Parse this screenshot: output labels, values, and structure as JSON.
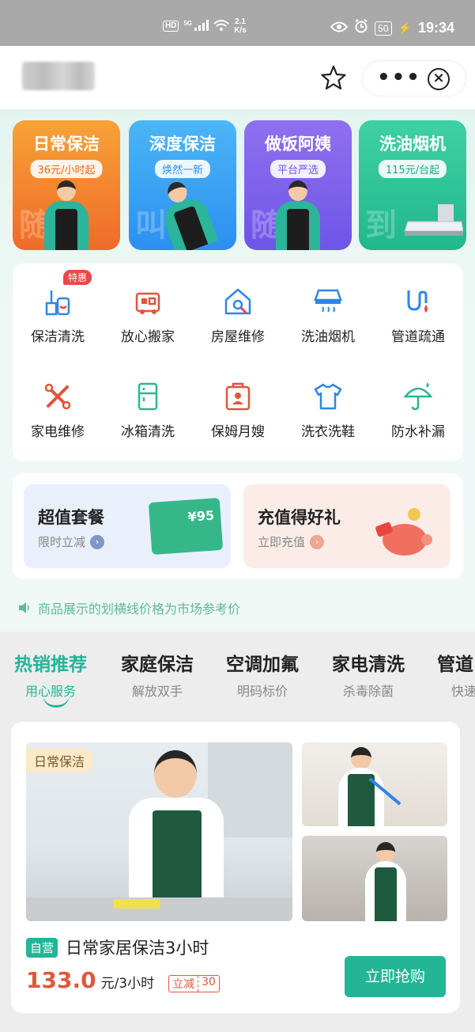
{
  "status_bar": {
    "network_hd": "HD",
    "network_type": "5G",
    "speed_value": "2.1",
    "speed_unit": "K/s",
    "battery": "50",
    "time": "19:34",
    "icons": [
      "eye-icon",
      "alarm-icon",
      "battery-icon",
      "charging-icon",
      "wifi-icon",
      "signal-icon"
    ]
  },
  "nav": {
    "icons": [
      "star-icon",
      "more-icon",
      "close-icon"
    ]
  },
  "banners": [
    {
      "title": "日常保洁",
      "tag": "36元/小时起",
      "color_from": "#f7a337",
      "color_to": "#f06a2a",
      "watermark": "随"
    },
    {
      "title": "深度保洁",
      "tag": "焕然一新",
      "color_from": "#4cb6f5",
      "color_to": "#2c8ff0",
      "watermark": "叫"
    },
    {
      "title": "做饭阿姨",
      "tag": "平台严选",
      "color_from": "#9070f0",
      "color_to": "#6d55e6",
      "watermark": "随"
    },
    {
      "title": "洗油烟机",
      "tag": "115元/台起",
      "color_from": "#3fd1a3",
      "color_to": "#21b88c",
      "watermark": "到"
    }
  ],
  "services": [
    {
      "label": "保洁清洗",
      "icon": "cleaning-icon",
      "color": "#2f86e6",
      "badge": "特惠"
    },
    {
      "label": "放心搬家",
      "icon": "moving-icon",
      "color": "#e2533a",
      "badge": ""
    },
    {
      "label": "房屋维修",
      "icon": "house-repair-icon",
      "color": "#2f86e6",
      "badge": ""
    },
    {
      "label": "洗油烟机",
      "icon": "range-hood-icon",
      "color": "#2f86e6",
      "badge": ""
    },
    {
      "label": "管道疏通",
      "icon": "pipe-icon",
      "color": "#2f86e6",
      "badge": ""
    },
    {
      "label": "家电维修",
      "icon": "appliance-repair-icon",
      "color": "#e2533a",
      "badge": ""
    },
    {
      "label": "冰箱清洗",
      "icon": "fridge-icon",
      "color": "#27b98d",
      "badge": ""
    },
    {
      "label": "保姆月嫂",
      "icon": "nanny-icon",
      "color": "#e2533a",
      "badge": ""
    },
    {
      "label": "洗衣洗鞋",
      "icon": "laundry-icon",
      "color": "#2f86e6",
      "badge": ""
    },
    {
      "label": "防水补漏",
      "icon": "umbrella-icon",
      "color": "#27b98d",
      "badge": ""
    }
  ],
  "promos": [
    {
      "title": "超值套餐",
      "sub": "限时立减",
      "bg": "#eaf0fb",
      "arrow_color": "#7f97c6",
      "ticket_value": "¥95"
    },
    {
      "title": "充值得好礼",
      "sub": "立即充值",
      "bg": "#fbece8",
      "arrow_color": "#f0a494"
    }
  ],
  "notice": {
    "text": "商品展示的划横线价格为市场参考价",
    "icon": "speaker-icon"
  },
  "tabs": [
    {
      "title": "热销推荐",
      "sub": "用心服务",
      "active": true
    },
    {
      "title": "家庭保洁",
      "sub": "解放双手",
      "active": false
    },
    {
      "title": "空调加氟",
      "sub": "明码标价",
      "active": false
    },
    {
      "title": "家电清洗",
      "sub": "杀毒除菌",
      "active": false
    },
    {
      "title": "管道",
      "sub": "快速",
      "active": false
    }
  ],
  "product": {
    "photo_tag": "日常保洁",
    "badge": "自营",
    "title": "日常家居保洁3小时",
    "price": "133.0",
    "unit": "元/3小时",
    "discount_label": "立减",
    "discount_value": "30",
    "buy_label": "立即抢购"
  },
  "colors": {
    "accent": "#24b596",
    "price": "#e0573d"
  }
}
